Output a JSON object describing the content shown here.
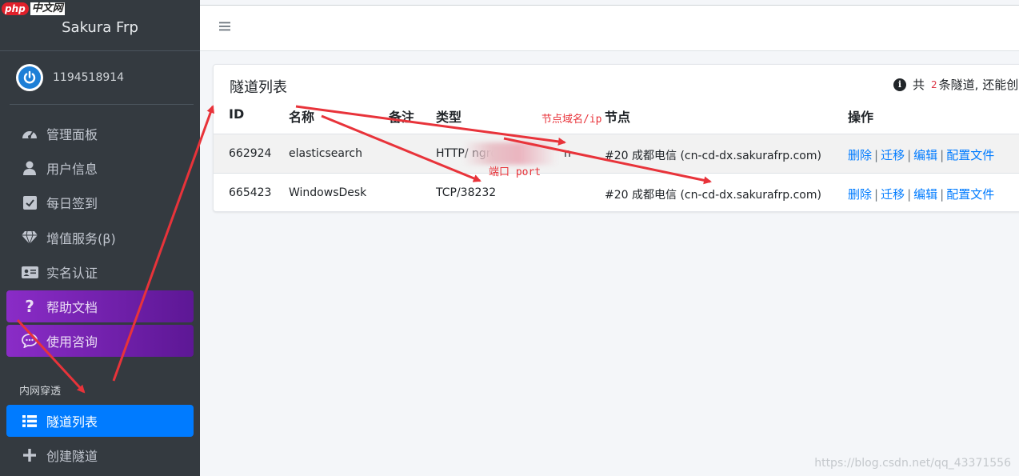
{
  "site_logo": {
    "badge": "php",
    "text": "中文网"
  },
  "sidebar": {
    "brand": "Sakura Frp",
    "user": "1194518914",
    "items": [
      {
        "label": "管理面板",
        "icon": "tachometer-icon"
      },
      {
        "label": "用户信息",
        "icon": "user-icon"
      },
      {
        "label": "每日签到",
        "icon": "checkbox-icon"
      },
      {
        "label": "增值服务(β)",
        "icon": "diamond-icon"
      },
      {
        "label": "实名认证",
        "icon": "id-card-icon"
      },
      {
        "label": "帮助文档",
        "icon": "question-icon"
      },
      {
        "label": "使用咨询",
        "icon": "chat-icon"
      }
    ],
    "section_header": "内网穿透",
    "section_items": [
      {
        "label": "隧道列表",
        "icon": "list-icon"
      },
      {
        "label": "创建隧道",
        "icon": "plus-icon"
      }
    ]
  },
  "card": {
    "title": "隧道列表",
    "info_prefix": "共",
    "info_count": "2",
    "info_suffix": "条隧道, 还能创",
    "columns": [
      "ID",
      "名称",
      "备注",
      "类型",
      "节点",
      "操作"
    ],
    "rows": [
      {
        "id": "662924",
        "name": "elasticsearch",
        "note": "",
        "type": "HTTP/ ngrok.",
        "type_tail": "n",
        "node": "#20 成都电信 (cn-cd-dx.sakurafrp.com)"
      },
      {
        "id": "665423",
        "name": "WindowsDesk",
        "note": "",
        "type": "TCP/38232",
        "type_tail": "",
        "node": "#20 成都电信 (cn-cd-dx.sakurafrp.com)"
      }
    ],
    "actions": [
      "删除",
      "迁移",
      "编辑",
      "配置文件"
    ]
  },
  "annotations": {
    "node_label": "节点域名/ip",
    "port_label": "端口 port"
  },
  "watermark": "https://blog.csdn.net/qq_43371556",
  "colors": {
    "sidebar": "#343a40",
    "active": "#007bff",
    "purple": "#8a2cc7",
    "link": "#007bff",
    "annotation": "#e8333a"
  }
}
